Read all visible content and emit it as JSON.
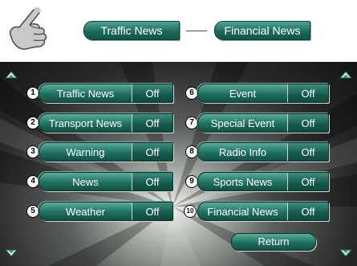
{
  "header": {
    "traffic_news_label": "Traffic News",
    "financial_news_label": "Financial News"
  },
  "left_column": [
    {
      "number": "1",
      "label": "Traffic News",
      "value": "Off"
    },
    {
      "number": "2",
      "label": "Transport News",
      "value": "Off"
    },
    {
      "number": "3",
      "label": "Warning",
      "value": "Off"
    },
    {
      "number": "4",
      "label": "News",
      "value": "Off"
    },
    {
      "number": "5",
      "label": "Weather",
      "value": "Off"
    }
  ],
  "right_column": [
    {
      "number": "6",
      "label": "Event",
      "value": "Off"
    },
    {
      "number": "7",
      "label": "Special Event",
      "value": "Off"
    },
    {
      "number": "8",
      "label": "Radio Info",
      "value": "Off"
    },
    {
      "number": "9",
      "label": "Sports News",
      "value": "Off"
    },
    {
      "number": "10",
      "label": "Financial News",
      "value": "Off"
    }
  ],
  "return_label": "Return",
  "icons": {
    "pointer": "pointing-hand-icon",
    "scroll_up": "scroll-up-arrow-icon",
    "scroll_down": "scroll-down-arrow-icon"
  },
  "colors": {
    "button_green": "#1f7060",
    "panel_dark": "#282a29",
    "callout_number_bg": "#ffffff"
  }
}
